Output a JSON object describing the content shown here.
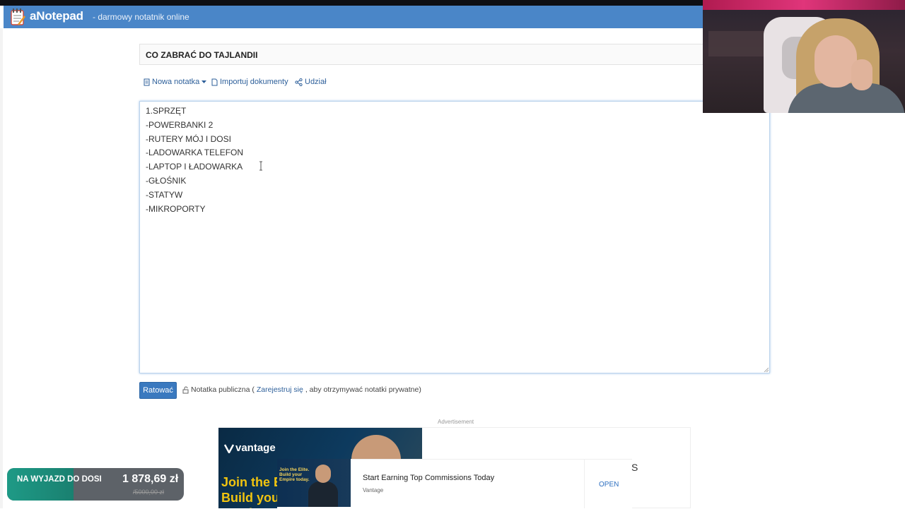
{
  "header": {
    "app_name": "aNotepad",
    "tagline": "- darmowy notatnik online"
  },
  "note": {
    "title": "CO ZABRAĆ DO TAJLANDII",
    "content": "1.SPRZĘT\n-POWERBANKI 2\n-RUTERY MÓJ I DOSI\n-LADOWARKA TELEFON\n-LAPTOP I ŁADOWARKA\n-GŁOŚNIK\n-STATYW\n-MIKROPORTY"
  },
  "toolbar": {
    "new_note": "Nowa notatka",
    "import": "Importuj dokumenty",
    "share": "Udział"
  },
  "actions": {
    "save": "Ratować",
    "public_prefix": "Notatka publiczna (",
    "register_link": "Zarejestruj się",
    "public_suffix": ", aby otrzymywać notatki prywatne)"
  },
  "ad": {
    "label": "Advertisement",
    "brand": "vantage",
    "headline": "Join the E\nBuild your\nEmpire tod",
    "thumb_text": "Join the Elite.\nBuild your\nEmpire today.",
    "title": "Start Earning Top Commissions Today",
    "sponsor": "Vantage",
    "cta": "OPEN",
    "trailing": "S"
  },
  "donation": {
    "label": "NA WYJAZD DO DOSI",
    "amount": "1 878,69 zł",
    "goal": "/5000,00 zł",
    "progress_fraction": 0.376
  },
  "colors": {
    "header_bg": "#4a86c8",
    "link": "#2d5f9a",
    "save_button": "#3a79bf",
    "donation_accent": "#1e9a86"
  }
}
